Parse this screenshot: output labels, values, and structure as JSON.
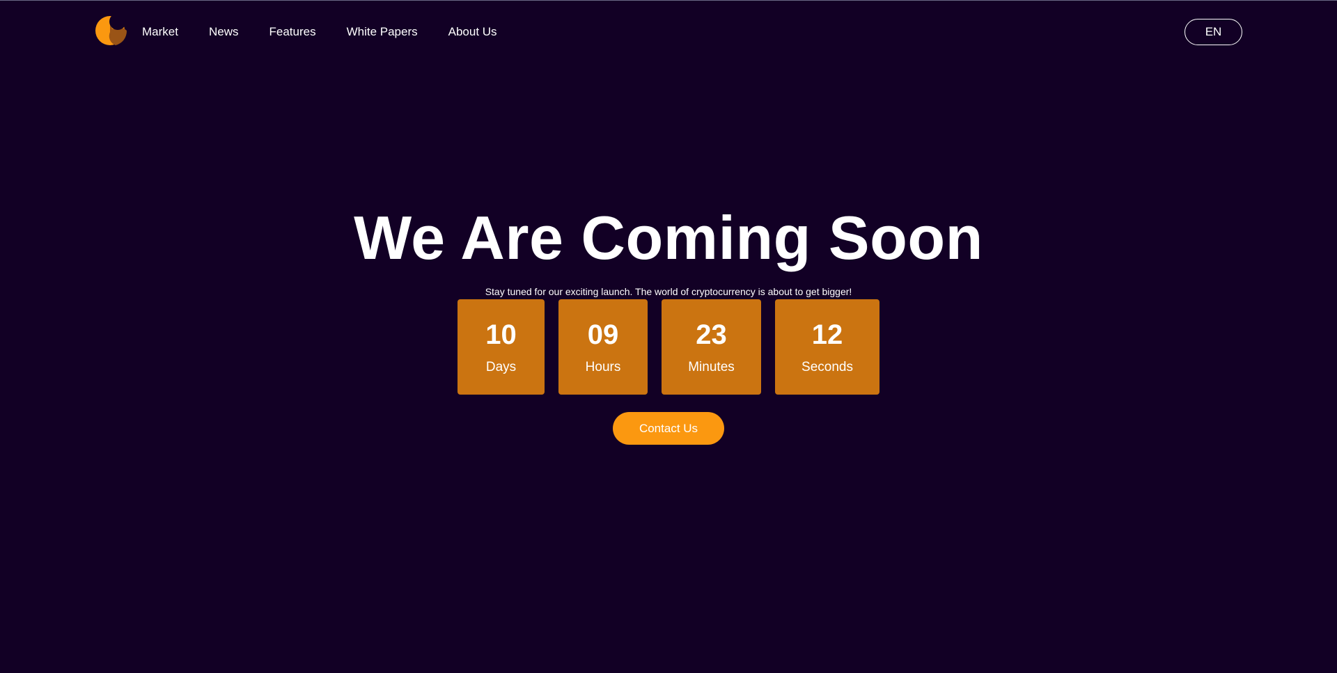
{
  "colors": {
    "background": "#120025",
    "accent": "#fb9810",
    "countdown_box": "#cb7411",
    "logo_dark": "#9a5416"
  },
  "header": {
    "logo_icon": "crescent-logo-icon",
    "nav": [
      "Market",
      "News",
      "Features",
      "White Papers",
      "About Us"
    ],
    "language": "EN"
  },
  "hero": {
    "title": "We Are Coming Soon",
    "subtitle": "Stay tuned for our exciting launch. The world of cryptocurrency is about to get bigger!"
  },
  "countdown": [
    {
      "value": "10",
      "label": "Days"
    },
    {
      "value": "09",
      "label": "Hours"
    },
    {
      "value": "23",
      "label": "Minutes"
    },
    {
      "value": "12",
      "label": "Seconds"
    }
  ],
  "cta": {
    "label": "Contact Us"
  }
}
